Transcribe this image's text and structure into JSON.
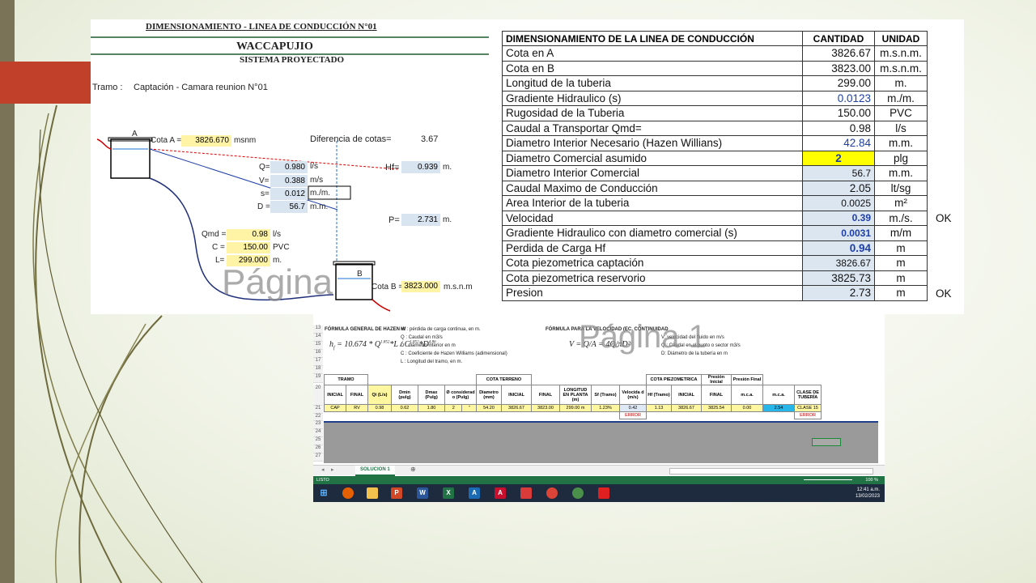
{
  "diagram": {
    "title": "DIMENSIONAMIENTO - LINEA DE CONDUCCIÓN N°01",
    "subtitle": "WACCAPUJIO",
    "system": "SISTEMA PROYECTADO",
    "tramo_label": "Tramo :",
    "tramo_value": "Captación -  Camara reunion N°01",
    "node_a": "A",
    "node_b": "B",
    "cota_a_label": "Cota A =",
    "cota_a_value": "3826.670",
    "cota_a_unit": "msnm",
    "diff_label": "Diferencia de cotas=",
    "diff_value": "3.67",
    "q_label": "Q=",
    "q_value": "0.980",
    "q_unit": "l/s",
    "v_label": "V=",
    "v_value": "0.388",
    "v_unit": "m/s",
    "s_label": "s=",
    "s_value": "0.012",
    "s_unit": "m./m.",
    "d_label": "D =",
    "d_value": "56.7",
    "d_unit": "m.m.",
    "hf_label": "Hf=",
    "hf_value": "0.939",
    "hf_unit": "m.",
    "p_label": "P=",
    "p_value": "2.731",
    "p_unit": "m.",
    "qmd_label": "Qmd =",
    "qmd_value": "0.98",
    "qmd_unit": "l/s",
    "c_label": "C =",
    "c_value": "150.00",
    "c_unit": "PVC",
    "l_label": "L=",
    "l_value": "299.000",
    "l_unit": "m.",
    "cota_b_label": "Cota B =",
    "cota_b_value": "3823.000",
    "cota_b_unit": "m.s.n.m",
    "watermark": "Página"
  },
  "dim_table": {
    "header": [
      "DIMENSIONAMIENTO DE LA LINEA DE CONDUCCIÓN",
      "CANTIDAD",
      "UNIDAD"
    ],
    "rows": [
      {
        "label": "Cota en A",
        "qty": "3826.67",
        "unit": "m.s.n.m."
      },
      {
        "label": "Cota en B",
        "qty": "3823.00",
        "unit": "m.s.n.m."
      },
      {
        "label": "Longitud de la tuberia",
        "qty": "299.00",
        "unit": "m."
      },
      {
        "label": "Gradiente Hidraulico (s)",
        "qty": "0.0123",
        "unit": "m./m."
      },
      {
        "label": "Rugosidad de la Tuberia",
        "qty": "150.00",
        "unit": "PVC"
      },
      {
        "label": "Caudal a Transportar  Qmd=",
        "qty": "0.98",
        "unit": "l/s"
      },
      {
        "label": "Diametro Interior Necesario (Hazen Willians)",
        "qty": "42.84",
        "unit": "m.m."
      },
      {
        "label": "Diametro Comercial asumido",
        "qty": "2",
        "unit": "plg"
      },
      {
        "label": "Diametro Interior Comercial",
        "qty": "56.7",
        "unit": "m.m."
      },
      {
        "label": "Caudal Maximo de Conducción",
        "qty": "2.05",
        "unit": "lt/sg"
      },
      {
        "label": "Area Interior de la tuberia",
        "qty": "0.0025",
        "unit": "m²"
      },
      {
        "label": "Velocidad",
        "qty": "0.39",
        "unit": "m./s."
      },
      {
        "label": "Gradiente Hidraulico con diametro comercial (s)",
        "qty": "0.0031",
        "unit": "m/m"
      },
      {
        "label": "Perdida de Carga Hf",
        "qty": "0.94",
        "unit": "m"
      },
      {
        "label": "Cota piezometrica captación",
        "qty": "3826.67",
        "unit": "m"
      },
      {
        "label": "Cota piezometrica reservorio",
        "qty": "3825.73",
        "unit": "m"
      },
      {
        "label": "Presion",
        "qty": "2.73",
        "unit": "m"
      }
    ],
    "ok_velocidad": "OK",
    "ok_presion": "OK"
  },
  "sheet": {
    "formula_title": "FÓRMULA GENERAL DE HAZEN W",
    "hf_desc": "Hf : pérdida de carga continua, en m.",
    "q_desc": "Q : Caudal en m3/s",
    "d_desc": "D : diámetro interior en m",
    "c_desc": "C : Coeficiente de Hazen Williams (adimensional)",
    "l_desc": "L : Longitud del tramo, en m.",
    "vel_title": "FÓRMULA PARA LA VELOCIDAD (EC. CONTINUIDAD",
    "v_desc": "V: velocidad del fluido en m/s",
    "q2_desc": "Q : Caudal en el punto o sector m3/s",
    "d2_desc": "D: Diámetro de la tubería en m",
    "watermark": "Página 1",
    "row_numbers": [
      "13",
      "14",
      "15",
      "16",
      "17",
      "18",
      "19",
      "20",
      "21",
      "22",
      "23",
      "24",
      "25",
      "26",
      "27"
    ],
    "group_headers": [
      "TRAMO",
      "COTA TERRENO",
      "COTA PIEZOMETRICA",
      "Presión Inicial",
      "Presión Final"
    ],
    "col_headers": [
      "INICIAL",
      "FINAL",
      "Qi (L/s)",
      "Dmin (pulg)",
      "Dmax (Pulg)",
      "Ø considerad o (Pulg)",
      "Diametro (mm)",
      "INICIAL",
      "FINAL",
      "LONGITUD EN PLANTA (m)",
      "Sf (Tramo)",
      "Velocida d (m/s)",
      "Hf (Tramo)",
      "INICIAL",
      "FINAL",
      "m.c.a.",
      "m.c.a.",
      "CLASE DE TUBERÍA"
    ],
    "data_row": [
      "CAP",
      "RV",
      "0.98",
      "0.62",
      "1.80",
      "2",
      "\"",
      "54.20",
      "3826.67",
      "3823.00",
      "299.00 m",
      "1.23%",
      "0.42",
      "1.13",
      "3826.67",
      "3825.54",
      "0.00",
      "2.54",
      "CLASE 15"
    ],
    "error1": "ERROR",
    "error2": "ERROR",
    "sheet_tab": "SOLUCION 1",
    "status": "LISTO",
    "zoom": "100 %",
    "time": "12:41 a.m.",
    "date": "13/02/2023"
  }
}
